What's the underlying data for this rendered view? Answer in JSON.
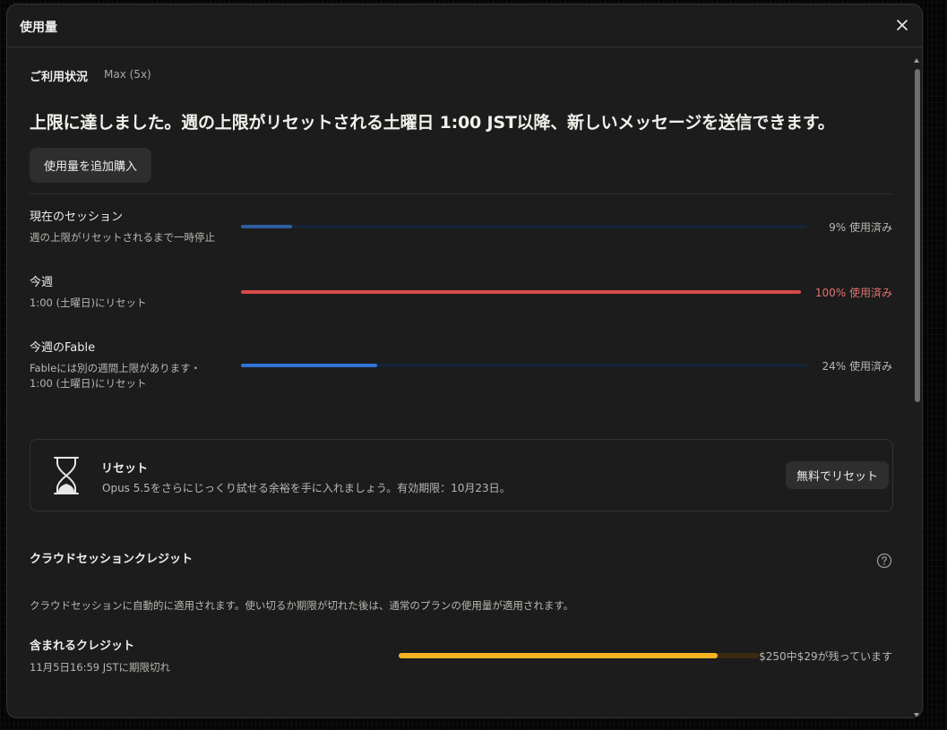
{
  "dialog": {
    "title": "使用量"
  },
  "status": {
    "section_title": "ご利用状況",
    "plan": "Max (5x)",
    "headline": "上限に達しました。週の上限がリセットされる土曜日 1:00 JST以降、新しいメッセージを送信できます。",
    "buy_button": "使用量を追加購入"
  },
  "usage": [
    {
      "label": "現在のセッション",
      "sub1": "週の上限がリセットされるまで一時停止",
      "sub2": "",
      "percent": 9,
      "value_text": "9% 使用済み",
      "bar_color": "#2f5e9e",
      "text_color": "#b9b7b2"
    },
    {
      "label": "今週",
      "sub1": "1:00 (土曜日)にリセット",
      "sub2": "",
      "percent": 100,
      "value_text": "100% 使用済み",
      "bar_color": "#d94a47",
      "text_color": "#e0716e"
    },
    {
      "label": "今週のFable",
      "sub1": "Fableには別の週間上限があります・",
      "sub2": "1:00 (土曜日)にリセット",
      "percent": 24,
      "value_text": "24% 使用済み",
      "bar_color": "#2f72d6",
      "text_color": "#b9b7b2"
    }
  ],
  "reset_card": {
    "icon": "hourglass-icon",
    "title": "リセット",
    "description": "Opus 5.5をさらにじっくり試せる余裕を手に入れましょう。有効期限：10月23日。",
    "button": "無料でリセット"
  },
  "credits": {
    "title": "クラウドセッションクレジット",
    "description": "クラウドセッションに自動的に適用されます。使い切るか期限が切れた後は、通常のプランの使用量が適用されます。",
    "label": "含まれるクレジット",
    "expiry": "11月5日16:59 JSTに期限切れ",
    "remaining_fraction": 0.885,
    "value_text": "$250中$29が残っています",
    "bar_color": "#f5b324",
    "track_color": "#3a2a10"
  }
}
